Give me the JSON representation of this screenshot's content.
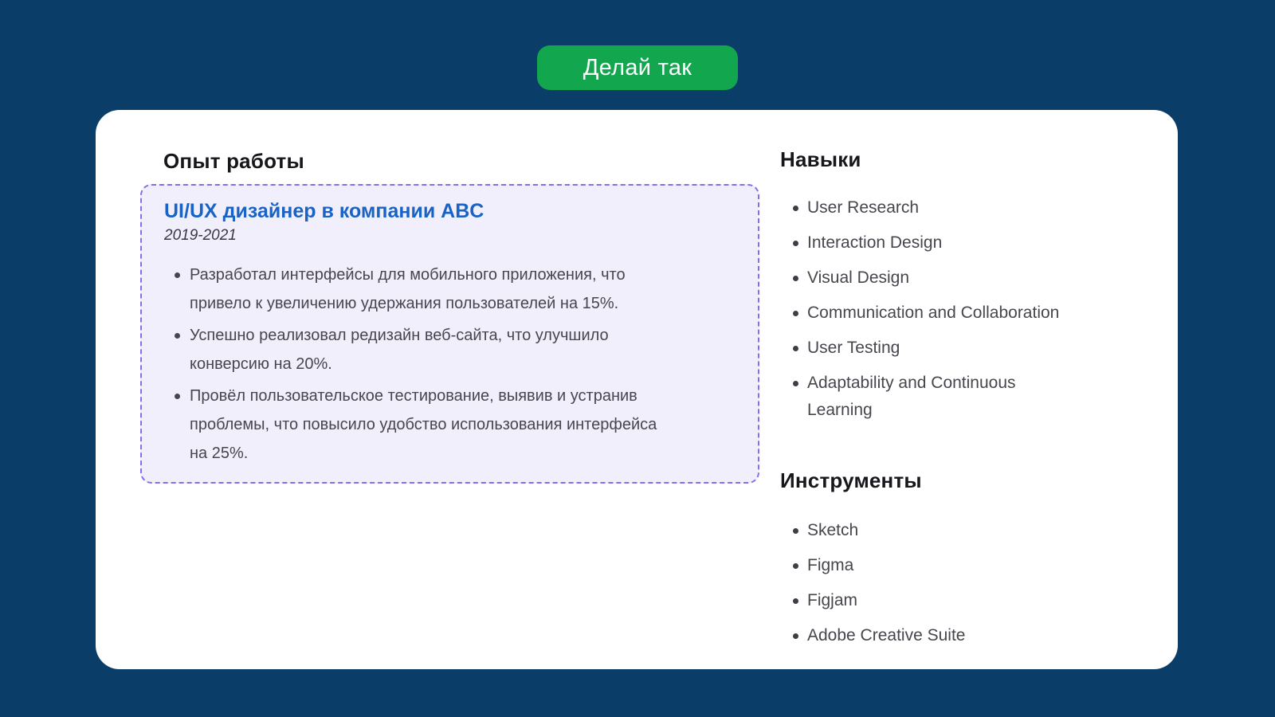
{
  "cta": {
    "label": "Делай так"
  },
  "experience": {
    "heading": "Опыт работы",
    "title": "UI/UX дизайнер в компании ABC",
    "period": "2019-2021",
    "achievements": [
      "Разработал интерфейсы для мобильного приложения, что привело к увеличению удержания пользователей на 15%.",
      "Успешно реализовал редизайн веб-сайта, что улучшило конверсию на 20%.",
      "Провёл пользовательское тестирование, выявив и устранив проблемы, что повысило удобство использования интерфейса на 25%."
    ]
  },
  "skills": {
    "heading": "Навыки",
    "items": [
      "User Research",
      "Interaction Design",
      "Visual Design",
      "Communication and Collaboration",
      "User Testing",
      "Adaptability and Continuous Learning"
    ]
  },
  "tools": {
    "heading": "Инструменты",
    "items": [
      "Sketch",
      "Figma",
      "Figjam",
      "Adobe Creative Suite"
    ]
  },
  "colors": {
    "page_background": "#0A3D68",
    "button_green": "#12A64F",
    "card_background": "#FFFFFF",
    "job_title_blue": "#1963C6",
    "highlight_border_purple": "#8070EE",
    "highlight_background_lavender": "#F1EFFC",
    "heading_text": "#17161B",
    "body_text": "#49454F"
  }
}
